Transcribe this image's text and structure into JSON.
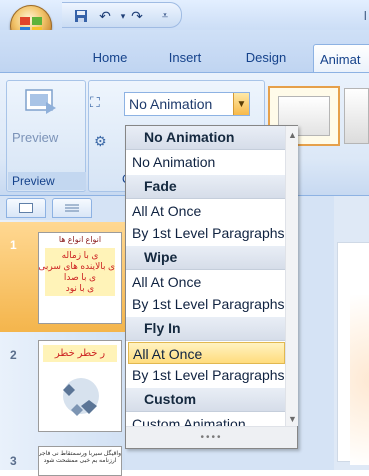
{
  "titlebar": {
    "title_fragment": "ا",
    "qat_icons": [
      "save-icon",
      "undo-icon",
      "redo-icon",
      "customize-qat-icon"
    ]
  },
  "tabs": [
    {
      "label": "Home"
    },
    {
      "label": "Insert"
    },
    {
      "label": "Design"
    },
    {
      "label": "Animat"
    }
  ],
  "ribbon": {
    "preview_button_label": "Preview",
    "preview_group_label": "Preview",
    "animation_combo_value": "No Animation",
    "animation_group_label_fragment": "C"
  },
  "dropdown": {
    "sections": [
      {
        "header": "No Animation",
        "items": [
          "No Animation"
        ]
      },
      {
        "header": "Fade",
        "items": [
          "All At Once",
          "By 1st Level Paragraphs"
        ]
      },
      {
        "header": "Wipe",
        "items": [
          "All At Once",
          "By 1st Level Paragraphs"
        ]
      },
      {
        "header": "Fly In",
        "items": [
          "All At Once",
          "By 1st Level Paragraphs"
        ]
      },
      {
        "header": "Custom",
        "items": [
          "Custom Animation..."
        ]
      }
    ],
    "selected": "Fly In / All At Once",
    "grip": "••••"
  },
  "slides_pane": {
    "slide_numbers": [
      "1",
      "2",
      "3"
    ],
    "slide1": {
      "title": "انواع انواع ها",
      "lines": [
        "ی با زماله",
        "ی بالاینده های سربی",
        "ی با صدا",
        "ی با نود"
      ]
    },
    "slide2": {
      "title": "ر خطر خطر"
    },
    "slide3": {
      "lines": [
        "واقیگل سیربا ورسمتقاط نی فاجی نداید باشند",
        "ارزنامه بم خبی ممشحت شود"
      ]
    }
  },
  "colors": {
    "ribbon_bg": "#dce8f7",
    "tab_text": "#15428b",
    "selected_slide": "#f4b54c",
    "selected_item": "#ffdc7d",
    "section_header_bg": "#d6dde9"
  }
}
